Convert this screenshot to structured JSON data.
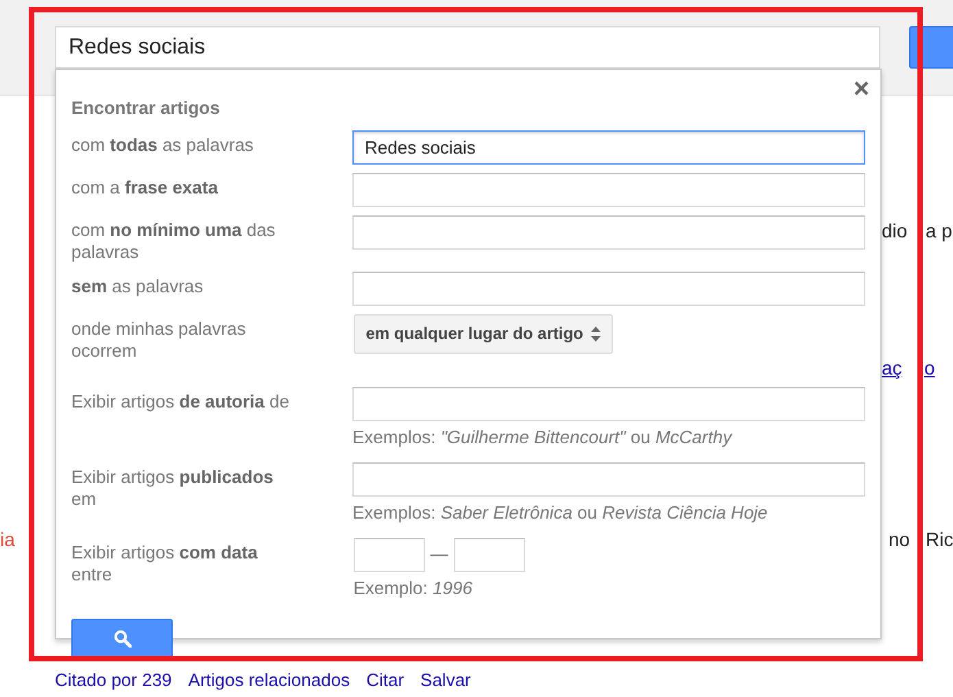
{
  "search_box": {
    "value": "Redes sociais"
  },
  "background": {
    "fragments": [
      {
        "kind": "text",
        "text": "dio"
      },
      {
        "kind": "text",
        "text": "a p"
      },
      {
        "kind": "link",
        "text": "aç"
      },
      {
        "kind": "link",
        "text": "o"
      },
      {
        "kind": "red",
        "text": "ia"
      },
      {
        "kind": "text",
        "text": "no"
      },
      {
        "kind": "text",
        "text": "Ric"
      }
    ],
    "result_links": [
      "Citado por 239",
      "Artigos relacionados",
      "Citar",
      "Salvar"
    ]
  },
  "advanced_search": {
    "title": "Encontrar artigos",
    "close": "×",
    "rows": [
      {
        "kind": "text",
        "label": "com **todas** as palavras",
        "value": "Redes sociais",
        "focused": true
      },
      {
        "kind": "text",
        "label": "com a **frase exata**",
        "focused": false
      },
      {
        "kind": "text",
        "label": "com **no mínimo uma** das palavras",
        "focused": false
      },
      {
        "kind": "text",
        "label": "**sem** as palavras",
        "focused": false
      },
      {
        "kind": "select",
        "label": "onde minhas palavras ocorrem",
        "value": "em qualquer lugar do artigo"
      },
      {
        "kind": "text",
        "label": "Exibir artigos **de autoria** de",
        "hint": "Exemplos: *\"Guilherme Bittencourt\"* ou *McCarthy*",
        "focused": false
      },
      {
        "kind": "text",
        "label": "Exibir artigos **publicados** em",
        "hint": "Exemplos: *Saber Eletrônica* ou *Revista Ciência Hoje*",
        "focused": false
      },
      {
        "kind": "range",
        "label": "Exibir artigos **com data** entre",
        "separator": "—",
        "hint": "Exemplo: *1996*"
      }
    ]
  }
}
